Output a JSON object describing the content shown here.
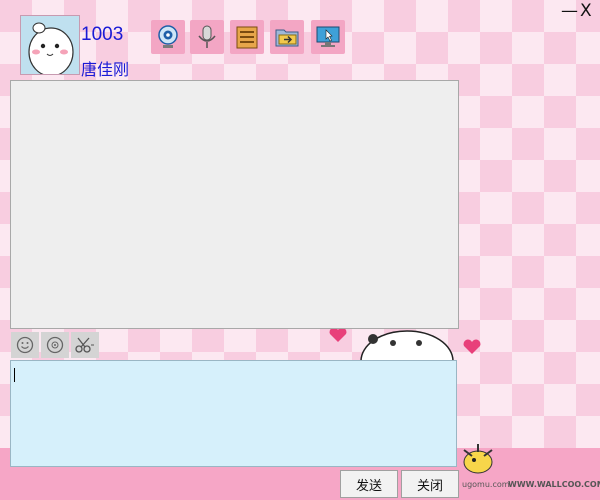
{
  "window": {
    "minimize_label": "—",
    "close_label": "X"
  },
  "user": {
    "id": "1003",
    "name": "唐佳刚"
  },
  "toolbar": {
    "icons": [
      "webcam-icon",
      "microphone-icon",
      "notebook-icon",
      "folder-transfer-icon",
      "remote-desktop-icon"
    ]
  },
  "input_tools": {
    "icons": [
      "emoticon-icon",
      "emoticon-alt-icon",
      "screenshot-icon"
    ]
  },
  "actions": {
    "send_label": "发送",
    "close_label": "关闭"
  },
  "watermark": {
    "left": "ugomu.com",
    "right": "WWW.WALLCOO.COM"
  },
  "colors": {
    "accent": "#1a1ad6",
    "input_bg": "#d6f0fb",
    "display_bg": "#eeeeee",
    "band": "#f6a6c6"
  }
}
